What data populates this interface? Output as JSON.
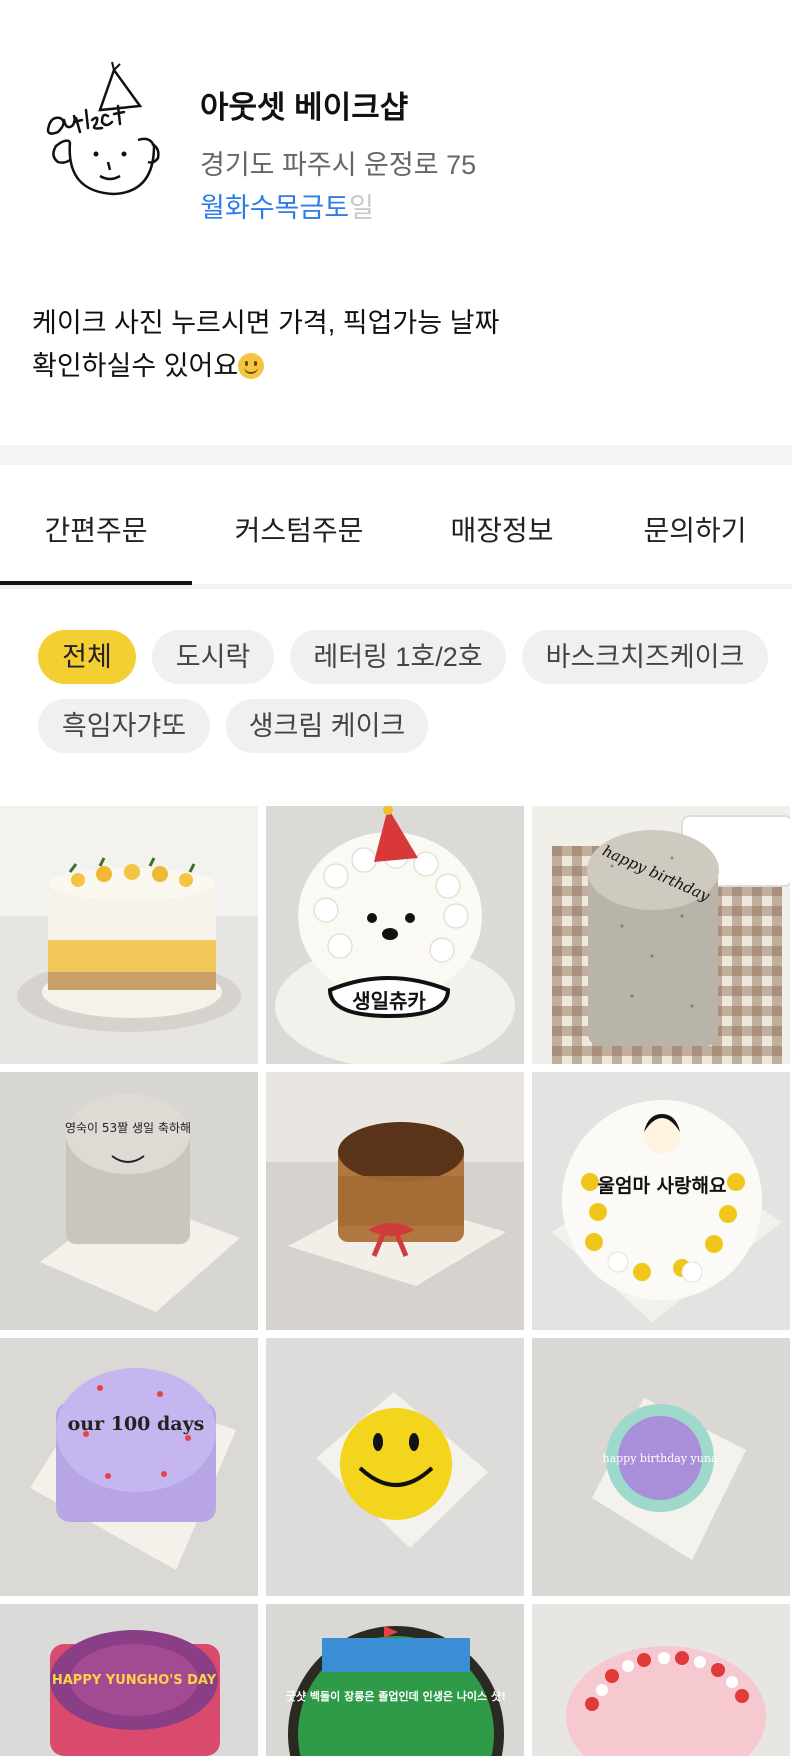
{
  "shop": {
    "name": "아웃셋 베이크샵",
    "address": "경기도 파주시 운정로 75",
    "days": [
      {
        "label": "월",
        "open": true
      },
      {
        "label": "화",
        "open": true
      },
      {
        "label": "수",
        "open": true
      },
      {
        "label": "목",
        "open": true
      },
      {
        "label": "금",
        "open": true
      },
      {
        "label": "토",
        "open": true
      },
      {
        "label": "일",
        "open": false
      }
    ],
    "colors": {
      "open_day": "#2f7be8",
      "closed_day": "#c8c8c8"
    }
  },
  "notice": {
    "line1": "케이크 사진 누르시면 가격, 픽업가능 날짜",
    "line2": "확인하실수 있어요",
    "emoji": "slightly-smiling-face"
  },
  "tabs": [
    {
      "label": "간편주문",
      "active": true
    },
    {
      "label": "커스텀주문",
      "active": false
    },
    {
      "label": "매장정보",
      "active": false
    },
    {
      "label": "문의하기",
      "active": false
    }
  ],
  "filters": [
    {
      "label": "전체",
      "active": true
    },
    {
      "label": "도시락",
      "active": false
    },
    {
      "label": "레터링 1호/2호",
      "active": false
    },
    {
      "label": "바스크치즈케이크",
      "active": false
    },
    {
      "label": "흑임자갸또",
      "active": false
    },
    {
      "label": "생크림 케이크",
      "active": false
    }
  ],
  "accent_color": "#f4cf32",
  "products": [
    {
      "kind": "mango-cake"
    },
    {
      "kind": "poodle-cake",
      "text": "생일츄카"
    },
    {
      "kind": "black-sesame-lunchbox",
      "text": "happy birthday"
    },
    {
      "kind": "black-sesame-cake",
      "text": "영숙이 53짤 생일 축하해"
    },
    {
      "kind": "basque-cheesecake"
    },
    {
      "kind": "flower-portrait-cake",
      "text": "울엄마 사랑해요"
    },
    {
      "kind": "lavender-cake",
      "text": "our 100 days"
    },
    {
      "kind": "smiley-cake"
    },
    {
      "kind": "mint-purple-cake",
      "text": "happy birthday yuna"
    },
    {
      "kind": "pink-lettering-cake",
      "text": "HAPPY YUNGHO'S DAY"
    },
    {
      "kind": "golf-cake",
      "text": "굿샷 백돌이 장롱은 졸업인데 인생은 나이스 샷!"
    },
    {
      "kind": "strawberry-cake"
    }
  ]
}
